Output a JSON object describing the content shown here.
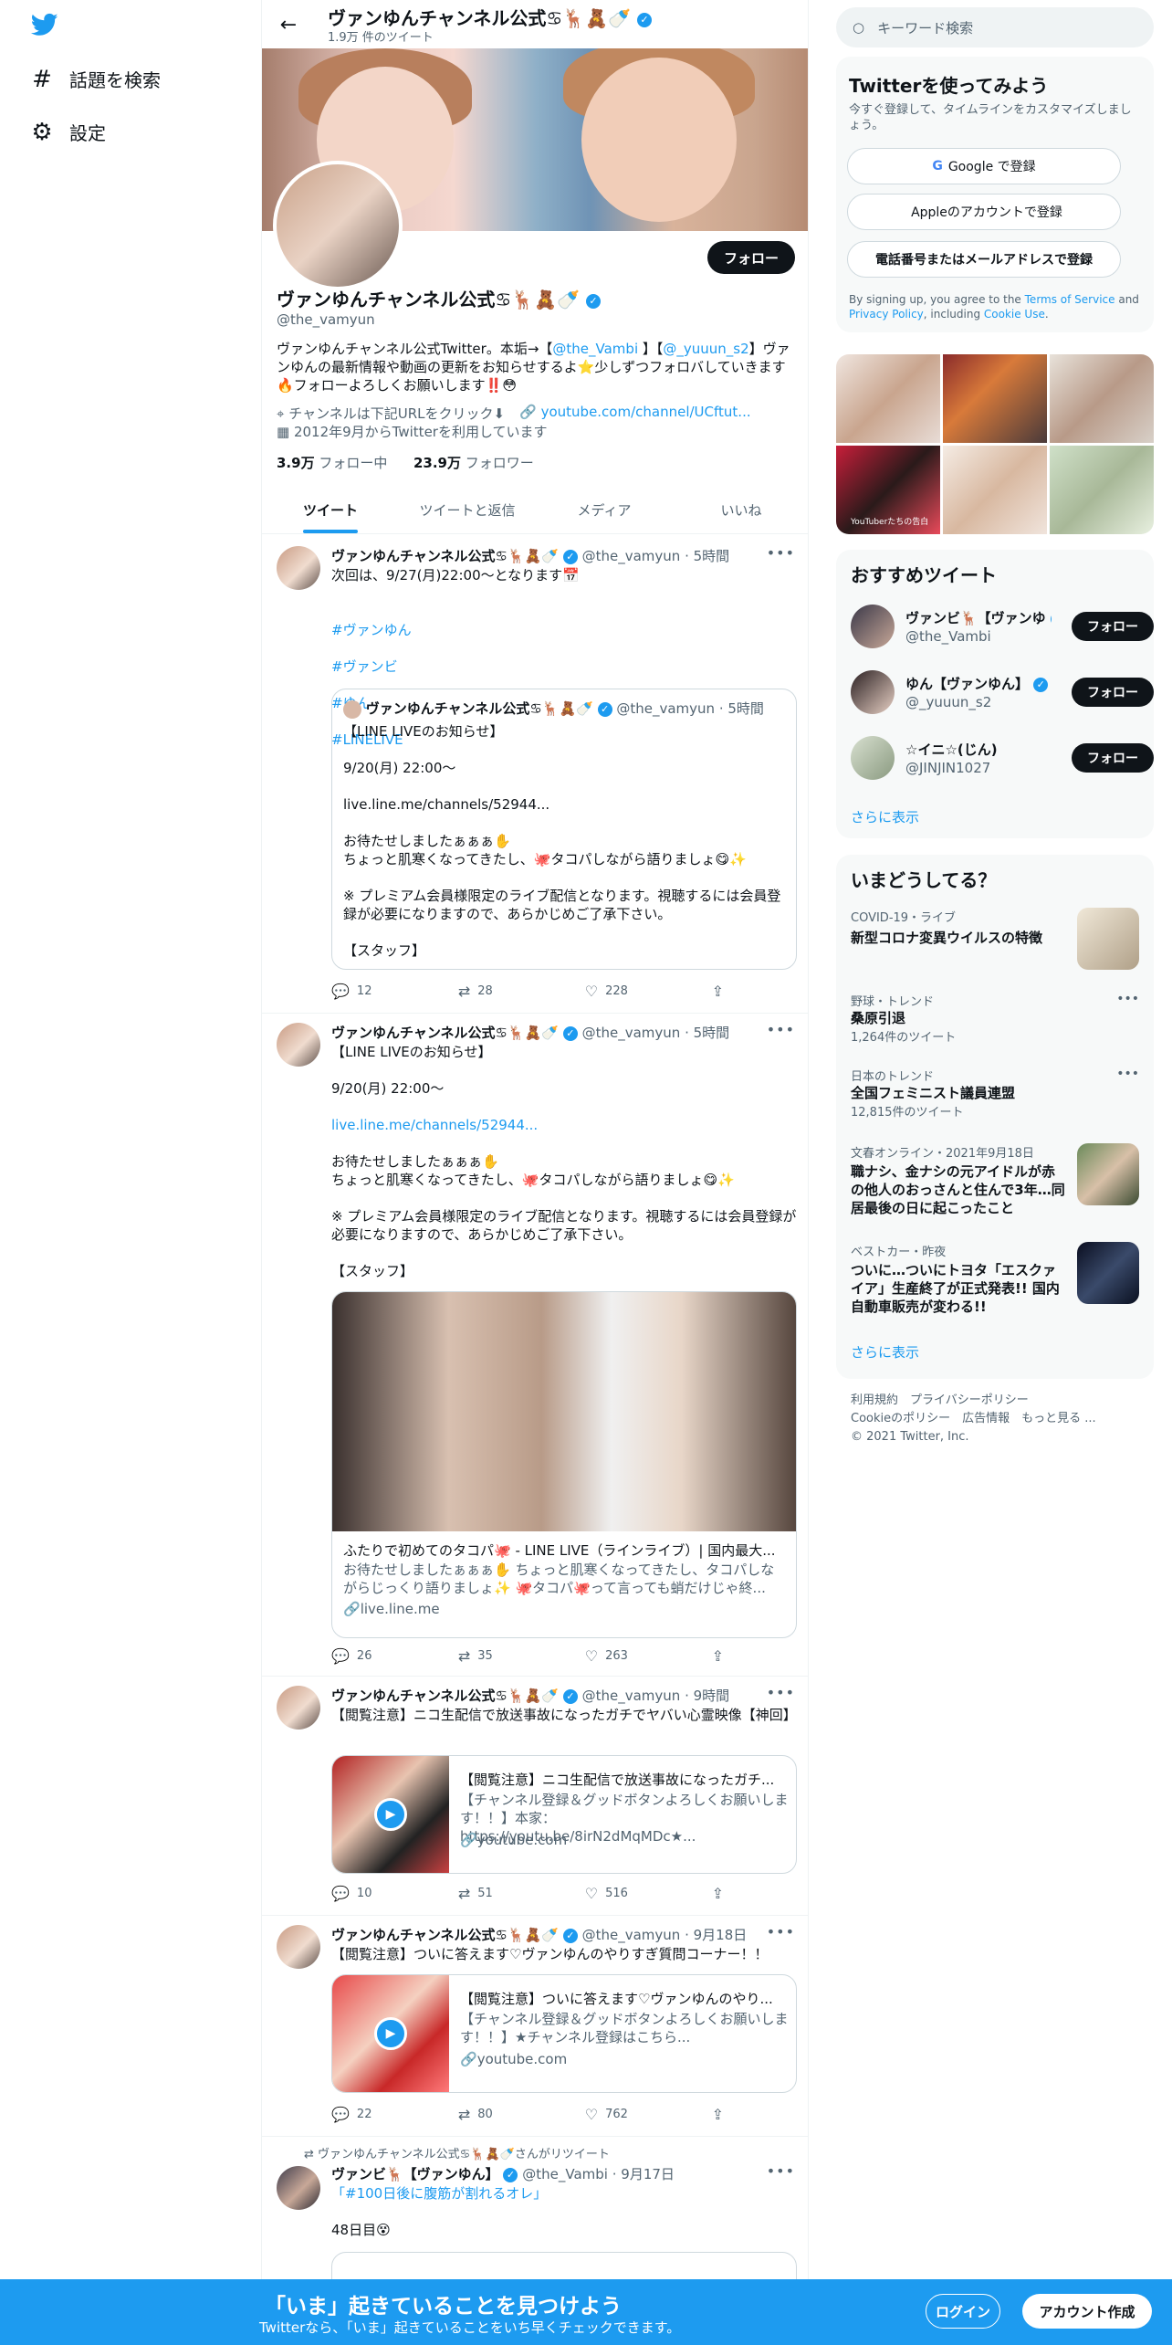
{
  "nav": {
    "explore": "話題を検索",
    "settings": "設定"
  },
  "profile": {
    "top_name": "ヴァンゆんチャンネル公式♋🦌🧸🍼",
    "tweet_count": "1.9万 件のツイート",
    "name": "ヴァンゆんチャンネル公式♋🦌🧸🍼",
    "handle": "@the_vamyun",
    "follow": "フォロー",
    "bio_pre": "ヴァンゆんチャンネル公式Twitter。本垢→【",
    "bio_link1": "@the_Vambi",
    "bio_mid": " 】【",
    "bio_link2": "@_yuuun_s2",
    "bio_post": "】ヴァンゆんの最新情報や動画の更新をお知らせするよ⭐少しずつフォロバしていきます🔥フォローよろしくお願いします‼️😳",
    "location": "チャンネルは下記URLをクリック⬇",
    "url": "youtube.com/channel/UCftut...",
    "joined": "2012年9月からTwitterを利用しています",
    "following_count": "3.9万",
    "following_label": "フォロー中",
    "followers_count": "23.9万",
    "followers_label": "フォロワー"
  },
  "tabs": [
    "ツイート",
    "ツイートと返信",
    "メディア",
    "いいね"
  ],
  "tweets": [
    {
      "name": "ヴァンゆんチャンネル公式♋🦌🧸🍼",
      "handle": "@the_vamyun",
      "time": "5時間",
      "text": "次回は、9/27(月)22:00〜となります📅",
      "hashtags": [
        "#ヴァン,ゆん",
        "#ヴァンビ",
        "#ゆん",
        "#LINELIVE"
      ],
      "quote": {
        "name": "ヴァンゆんチャンネル公式♋🦌🧸🍼",
        "handle": "@the_vamyun",
        "time": "5時間",
        "text": "【LINE LIVEのお知らせ】\n\n9/20(月) 22:00〜\n\nlive.line.me/channels/52944...\n\nお待たせしましたぁぁぁ✋\nちょっと肌寒くなってきたし、🐙タコパしながら語りましょ😋✨\n\n※ プレミアム会員様限定のライブ配信となります。視聴するには会員登録が必要になりますので、あらかじめご了承下さい。\n\n【スタッフ】"
      },
      "replies": "12",
      "retweets": "28",
      "likes": "228"
    },
    {
      "name": "ヴァンゆんチャンネル公式♋🦌🧸🍼",
      "handle": "@the_vamyun",
      "time": "5時間",
      "text1": "【LINE LIVEのお知らせ】\n\n9/20(月) 22:00〜\n",
      "link": "live.line.me/channels/52944...",
      "text2": "\nお待たせしましたぁぁぁ✋\nちょっと肌寒くなってきたし、🐙タコパしながら語りましょ😋✨\n\n※ プレミアム会員様限定のライブ配信となります。視聴するには会員登録が必要になりますので、あらかじめご了承下さい。\n\n【スタッフ】",
      "card_title": "ふたりで初めてのタコパ🐙 - LINE LIVE（ラインライブ）| 国内最大...",
      "card_desc": "お待たせしましたぁぁぁ✋ ちょっと肌寒くなってきたし、タコパしながらじっくり語りましょ✨ 🐙タコパ🐙って言っても蛸だけじゃ終...",
      "card_domain": "live.line.me",
      "replies": "26",
      "retweets": "35",
      "likes": "263"
    },
    {
      "name": "ヴァンゆんチャンネル公式♋🦌🧸🍼",
      "handle": "@the_vamyun",
      "time": "9時間",
      "text": "【閲覧注意】ニコ生配信で放送事故になったガチでヤバい心霊映像【神回】",
      "card_title": "【閲覧注意】ニコ生配信で放送事故になったガチ...",
      "card_desc": "【チャンネル登録＆グッドボタンよろしくお願いします！！】本家：https://youtu.be/8irN2dMqMDc★...",
      "card_domain": "youtube.com",
      "replies": "10",
      "retweets": "51",
      "likes": "516"
    },
    {
      "name": "ヴァンゆんチャンネル公式♋🦌🧸🍼",
      "handle": "@the_vamyun",
      "time": "9月18日",
      "text": "【閲覧注意】ついに答えます♡ヴァンゆんのやりすぎ質問コーナー！！",
      "card_title": "【閲覧注意】ついに答えます♡ヴァンゆんのやり...",
      "card_desc": "【チャンネル登録＆グッドボタンよろしくお願いします！！】★チャンネル登録はこちら...",
      "card_domain": "youtube.com",
      "replies": "22",
      "retweets": "80",
      "likes": "762"
    },
    {
      "retweeted_by": "ヴァンゆんチャンネル公式♋🦌🧸🍼さんがリツイート",
      "name": "ヴァンビ🦌【ヴァンゆん】",
      "handle": "@the_Vambi",
      "time": "9月17日",
      "text": "「#100日後に腹筋が割れるオレ」",
      "text2": "48日目😵"
    }
  ],
  "search": {
    "placeholder": "キーワード検索"
  },
  "signup": {
    "title": "Twitterを使ってみよう",
    "sub": "今すぐ登録して、タイムラインをカスタマイズしましょう。",
    "google": "Google で登録",
    "apple": "Appleのアカウントで登録",
    "phone": "電話番号またはメールアドレスで登録",
    "terms_pre": "By signing up, you agree to the ",
    "terms": "Terms of Service",
    "and": " and ",
    "privacy": "Privacy Policy",
    "including": ", including ",
    "cookie": "Cookie Use",
    "period": "."
  },
  "photo_caption": "YouTuberたちの告白",
  "recommended": {
    "title": "おすすめツイート",
    "users": [
      {
        "name": "ヴァンビ🦌【ヴァンゆ",
        "handle": "@the_Vambi",
        "button": "フォロー"
      },
      {
        "name": "ゆん【ヴァンゆん】",
        "handle": "@_yuuun_s2",
        "button": "フォロー"
      },
      {
        "name": "☆イニ☆(じん)",
        "handle": "@JINJIN1027",
        "button": "フォロー"
      }
    ],
    "more": "さらに表示"
  },
  "trends": {
    "title": "いまどうしてる？",
    "items": [
      {
        "context": "COVID-19・ライブ",
        "title": "新型コロナ変異ウイルスの特徴"
      },
      {
        "context": "野球・トレンド",
        "title": "桑原引退",
        "count": "1,264件のツイート"
      },
      {
        "context": "日本のトレンド",
        "title": "全国フェミニスト議員連盟",
        "count": "12,815件のツイート"
      },
      {
        "context": "文春オンライン・2021年9月18日",
        "title": "職ナシ、金ナシの元アイドルが赤の他人のおっさんと住んで3年…同居最後の日に起こったこと"
      },
      {
        "context": "ベストカー・昨夜",
        "title": "ついに…ついにトヨタ「エスクァイア」生産終了が正式発表!! 国内自動車販売が変わる!!"
      }
    ],
    "more": "さらに表示"
  },
  "footer": {
    "line1": "利用規約　プライバシーポリシー",
    "line2": "Cookieのポリシー　広告情報　もっと見る ...",
    "line3": "© 2021 Twitter, Inc."
  },
  "bottom": {
    "title": "「いま」起きていることを見つけよう",
    "sub": "Twitterなら、「いま」起きていることをいち早くチェックできます。",
    "login": "ログイン",
    "signup": "アカウント作成"
  },
  "colors": {
    "accent": "#1d9bf0",
    "text": "#0f1419",
    "muted": "#536471"
  }
}
